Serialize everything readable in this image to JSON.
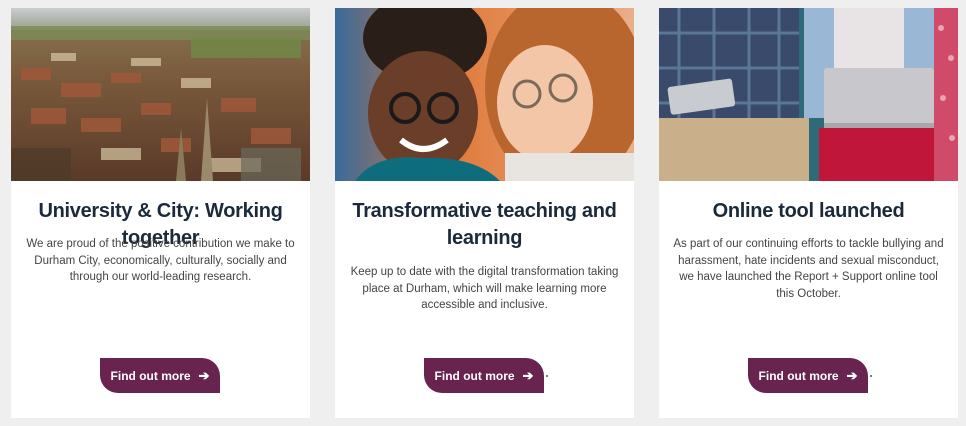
{
  "cards": [
    {
      "image_alt": "Aerial view of Durham city",
      "title": "University & City: Working together",
      "text": "We are proud of the positive contribution we make to Durham City, economically, culturally, socially and through our world-leading research.",
      "button_label": "Find out more",
      "button_icon": "arrow-right-icon"
    },
    {
      "image_alt": "Two students smiling at a screen",
      "title": "Transformative teaching and learning",
      "text": "Keep up to date with the digital transformation taking place at Durham, which will make learning more accessible and inclusive.",
      "button_label": "Find out more",
      "button_icon": "arrow-right-icon"
    },
    {
      "image_alt": "Students using a tablet and laptop",
      "title": "Online tool launched",
      "text": "As part of our continuing efforts to tackle bullying and harassment, hate incidents and sexual misconduct, we have launched the Report + Support online tool this October.",
      "button_label": "Find out more",
      "button_icon": "arrow-right-icon"
    }
  ],
  "colors": {
    "button_bg": "#68244f",
    "title": "#1b2a3a",
    "page_bg": "#efefef"
  }
}
